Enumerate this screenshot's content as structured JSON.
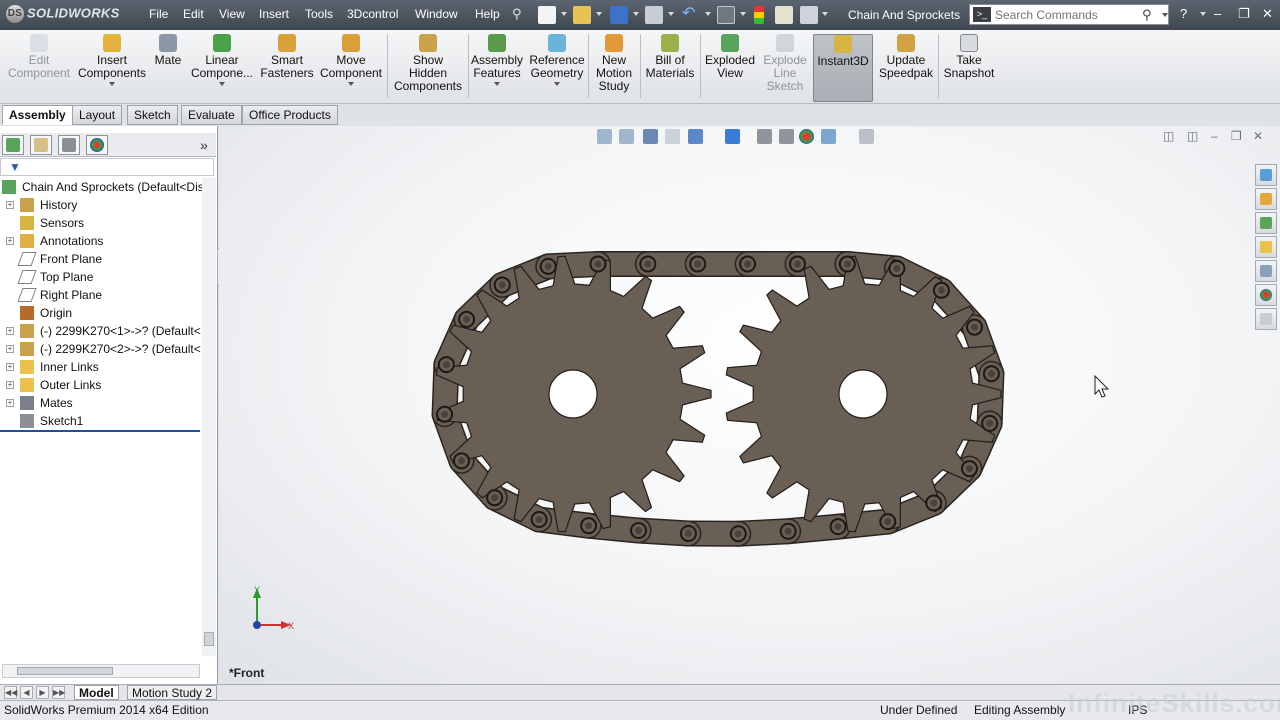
{
  "app": {
    "logo_text": "SOLIDWORKS",
    "document_title": "Chain And Sprockets"
  },
  "menu": [
    "File",
    "Edit",
    "View",
    "Insert",
    "Tools",
    "3Dcontrol",
    "Window",
    "Help"
  ],
  "search": {
    "placeholder": "Search Commands"
  },
  "commands": {
    "edit_component": "Edit\nComponent",
    "insert_components": "Insert\nComponents",
    "mate": "Mate",
    "linear_component": "Linear\nCompone...",
    "smart_fasteners": "Smart\nFasteners",
    "move_component": "Move\nComponent",
    "show_hidden": "Show\nHidden\nComponents",
    "assembly_features": "Assembly\nFeatures",
    "reference_geometry": "Reference\nGeometry",
    "new_motion_study": "New\nMotion\nStudy",
    "bill_of_materials": "Bill of\nMaterials",
    "exploded_view": "Exploded\nView",
    "explode_line_sketch": "Explode\nLine\nSketch",
    "instant3d": "Instant3D",
    "update_speedpak": "Update\nSpeedpak",
    "take_snapshot": "Take\nSnapshot"
  },
  "tabs": [
    "Assembly",
    "Layout",
    "Sketch",
    "Evaluate",
    "Office Products"
  ],
  "tree": [
    {
      "label": "Chain And Sprockets  (Default<Displ",
      "level": 0
    },
    {
      "label": "History",
      "level": 1,
      "expand": true
    },
    {
      "label": "Sensors",
      "level": 1
    },
    {
      "label": "Annotations",
      "level": 1,
      "expand": true
    },
    {
      "label": "Front Plane",
      "level": 1
    },
    {
      "label": "Top Plane",
      "level": 1
    },
    {
      "label": "Right Plane",
      "level": 1
    },
    {
      "label": "Origin",
      "level": 1
    },
    {
      "label": "(-) 2299K270<1>->? (Default<",
      "level": 1,
      "expand": true
    },
    {
      "label": "(-) 2299K270<2>->? (Default<",
      "level": 1,
      "expand": true
    },
    {
      "label": "Inner Links",
      "level": 1,
      "expand": true
    },
    {
      "label": "Outer Links",
      "level": 1,
      "expand": true
    },
    {
      "label": "Mates",
      "level": 1,
      "expand": true
    },
    {
      "label": "Sketch1",
      "level": 1
    }
  ],
  "viewport": {
    "view_label": "*Front",
    "triad_y": "Y",
    "triad_x": "X"
  },
  "bottom_tabs": [
    "Model",
    "Motion Study 2"
  ],
  "status": {
    "edition": "SolidWorks Premium 2014 x64 Edition",
    "definition": "Under Defined",
    "mode": "Editing Assembly",
    "units": "IPS"
  },
  "watermark": "InfiniteSkills.com",
  "colors": {
    "part": "#6a5f55",
    "accent": "#2a62b8",
    "titlebar": "#4a525a"
  }
}
